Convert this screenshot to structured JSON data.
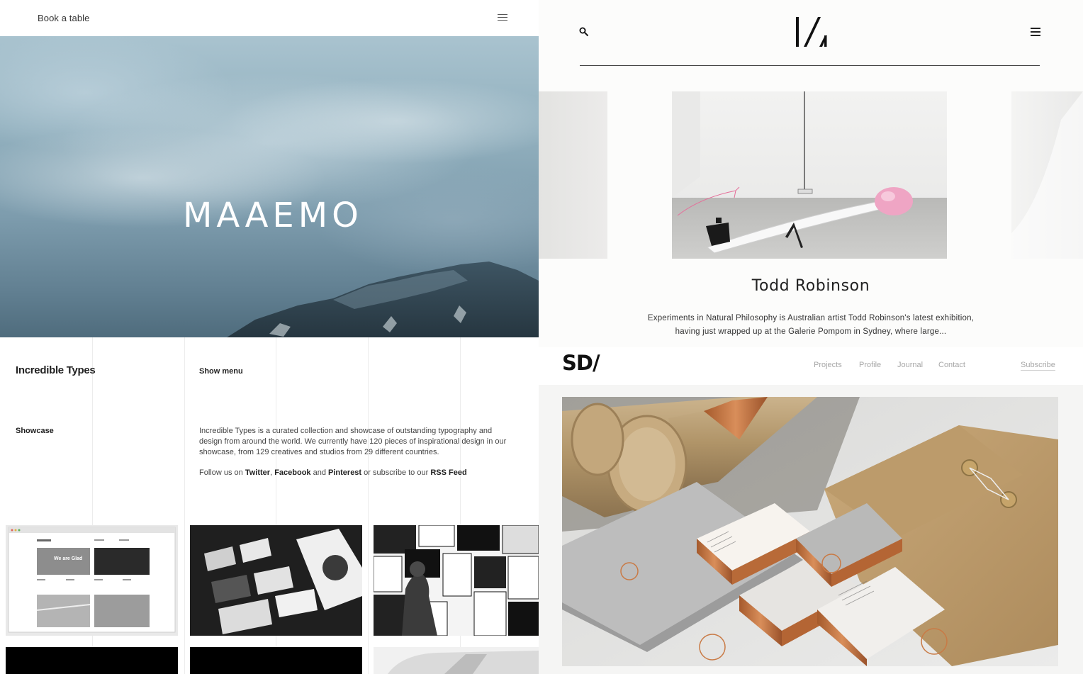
{
  "maaemo": {
    "book_label": "Book a table",
    "logo_text": "MAAEMO"
  },
  "todd": {
    "title": "Todd Robinson",
    "description": "Experiments in Natural Philosophy is Australian artist Todd Robinson's latest exhibition, having just wrapped up at the Galerie Pompom in Sydney, where large..."
  },
  "types": {
    "brand": "Incredible Types",
    "show_menu": "Show menu",
    "showcase": "Showcase",
    "intro": "Incredible Types is a curated collection and showcase of outstanding typography and design from around the world. We currently have 120 pieces of inspirational design in our showcase, from 129 creatives and studios from 29 different countries.",
    "follow_prefix": "Follow us on ",
    "twitter": "Twitter",
    "comma": ", ",
    "facebook": "Facebook",
    "and": " and ",
    "pinterest": "Pinterest",
    "or_subscribe": " or subscribe to our ",
    "rss": "RSS Feed",
    "thumb_text": "We are Glad"
  },
  "sd": {
    "logo": "SD/",
    "nav": [
      "Projects",
      "Profile",
      "Journal",
      "Contact"
    ],
    "subscribe": "Subscribe"
  },
  "colors": {
    "sky_light": "#a9c3cf",
    "sky_dark": "#4f6c7d",
    "nav_gray": "#a7a7a7",
    "kraft": "#b8986c",
    "copper": "#c0703e"
  }
}
